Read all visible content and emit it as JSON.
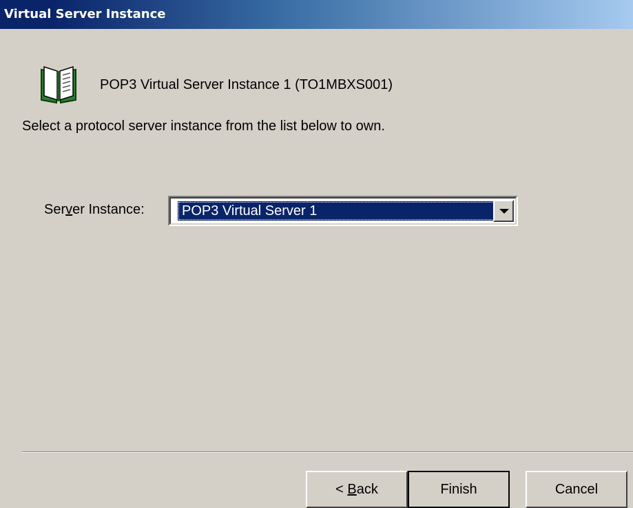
{
  "window": {
    "title": "Virtual Server Instance"
  },
  "header": {
    "icon": "book-icon",
    "instance_title": "POP3 Virtual Server Instance 1 (TO1MBXS001)"
  },
  "instructions": "Select a protocol server instance from the list below to own.",
  "server_instance": {
    "label_prefix": "Ser",
    "label_mnemonic": "v",
    "label_suffix": "er Instance:",
    "selected_value": "POP3 Virtual Server 1"
  },
  "buttons": {
    "back_prefix": "< ",
    "back_mnemonic": "B",
    "back_suffix": "ack",
    "finish": "Finish",
    "cancel": "Cancel"
  },
  "colors": {
    "dialog_background": "#d4d0c8",
    "titlebar_start": "#0a246a",
    "titlebar_end": "#a6caf0",
    "selection": "#0a246a",
    "book_green": "#2e7d32"
  }
}
